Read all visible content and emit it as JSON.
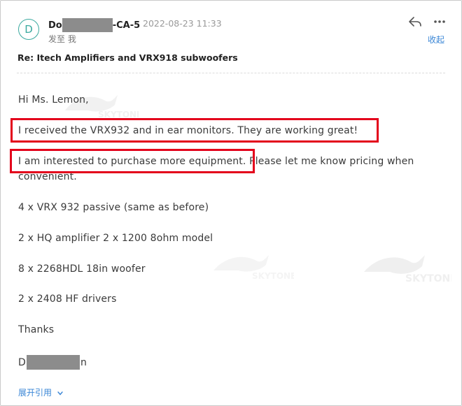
{
  "header": {
    "avatar_letter": "D",
    "sender_start": "Do",
    "sender_end": "-CA-5",
    "datetime": "2022-08-23 11:33",
    "recipient": "发至 我",
    "collapse_label": "收起"
  },
  "email": {
    "subject": "Re: Itech Amplifiers and VRX918 subwoofers",
    "greeting": "Hi Ms. Lemon,",
    "line1": "I received the VRX932 and in ear monitors. They are working great!",
    "line2_a": "I am interested to purchase more equipment. Please let me know pricing when",
    "line2_b": "convenient.",
    "item1": "4 x VRX 932 passive  (same as before)",
    "item2": "2 x  HQ amplifier  2 x 1200 8ohm  model",
    "item3": "8 x   2268HDL   18in woofer",
    "item4": "2 x 2408  HF drivers",
    "thanks": "Thanks",
    "signature_start": "D",
    "signature_end": "n"
  },
  "footer": {
    "expand_label": "展开引用"
  },
  "watermark": {
    "text": "SKYTONE"
  },
  "colors": {
    "highlight": "#e3001b",
    "link": "#3a86d6",
    "avatar": "#3aa99f"
  }
}
